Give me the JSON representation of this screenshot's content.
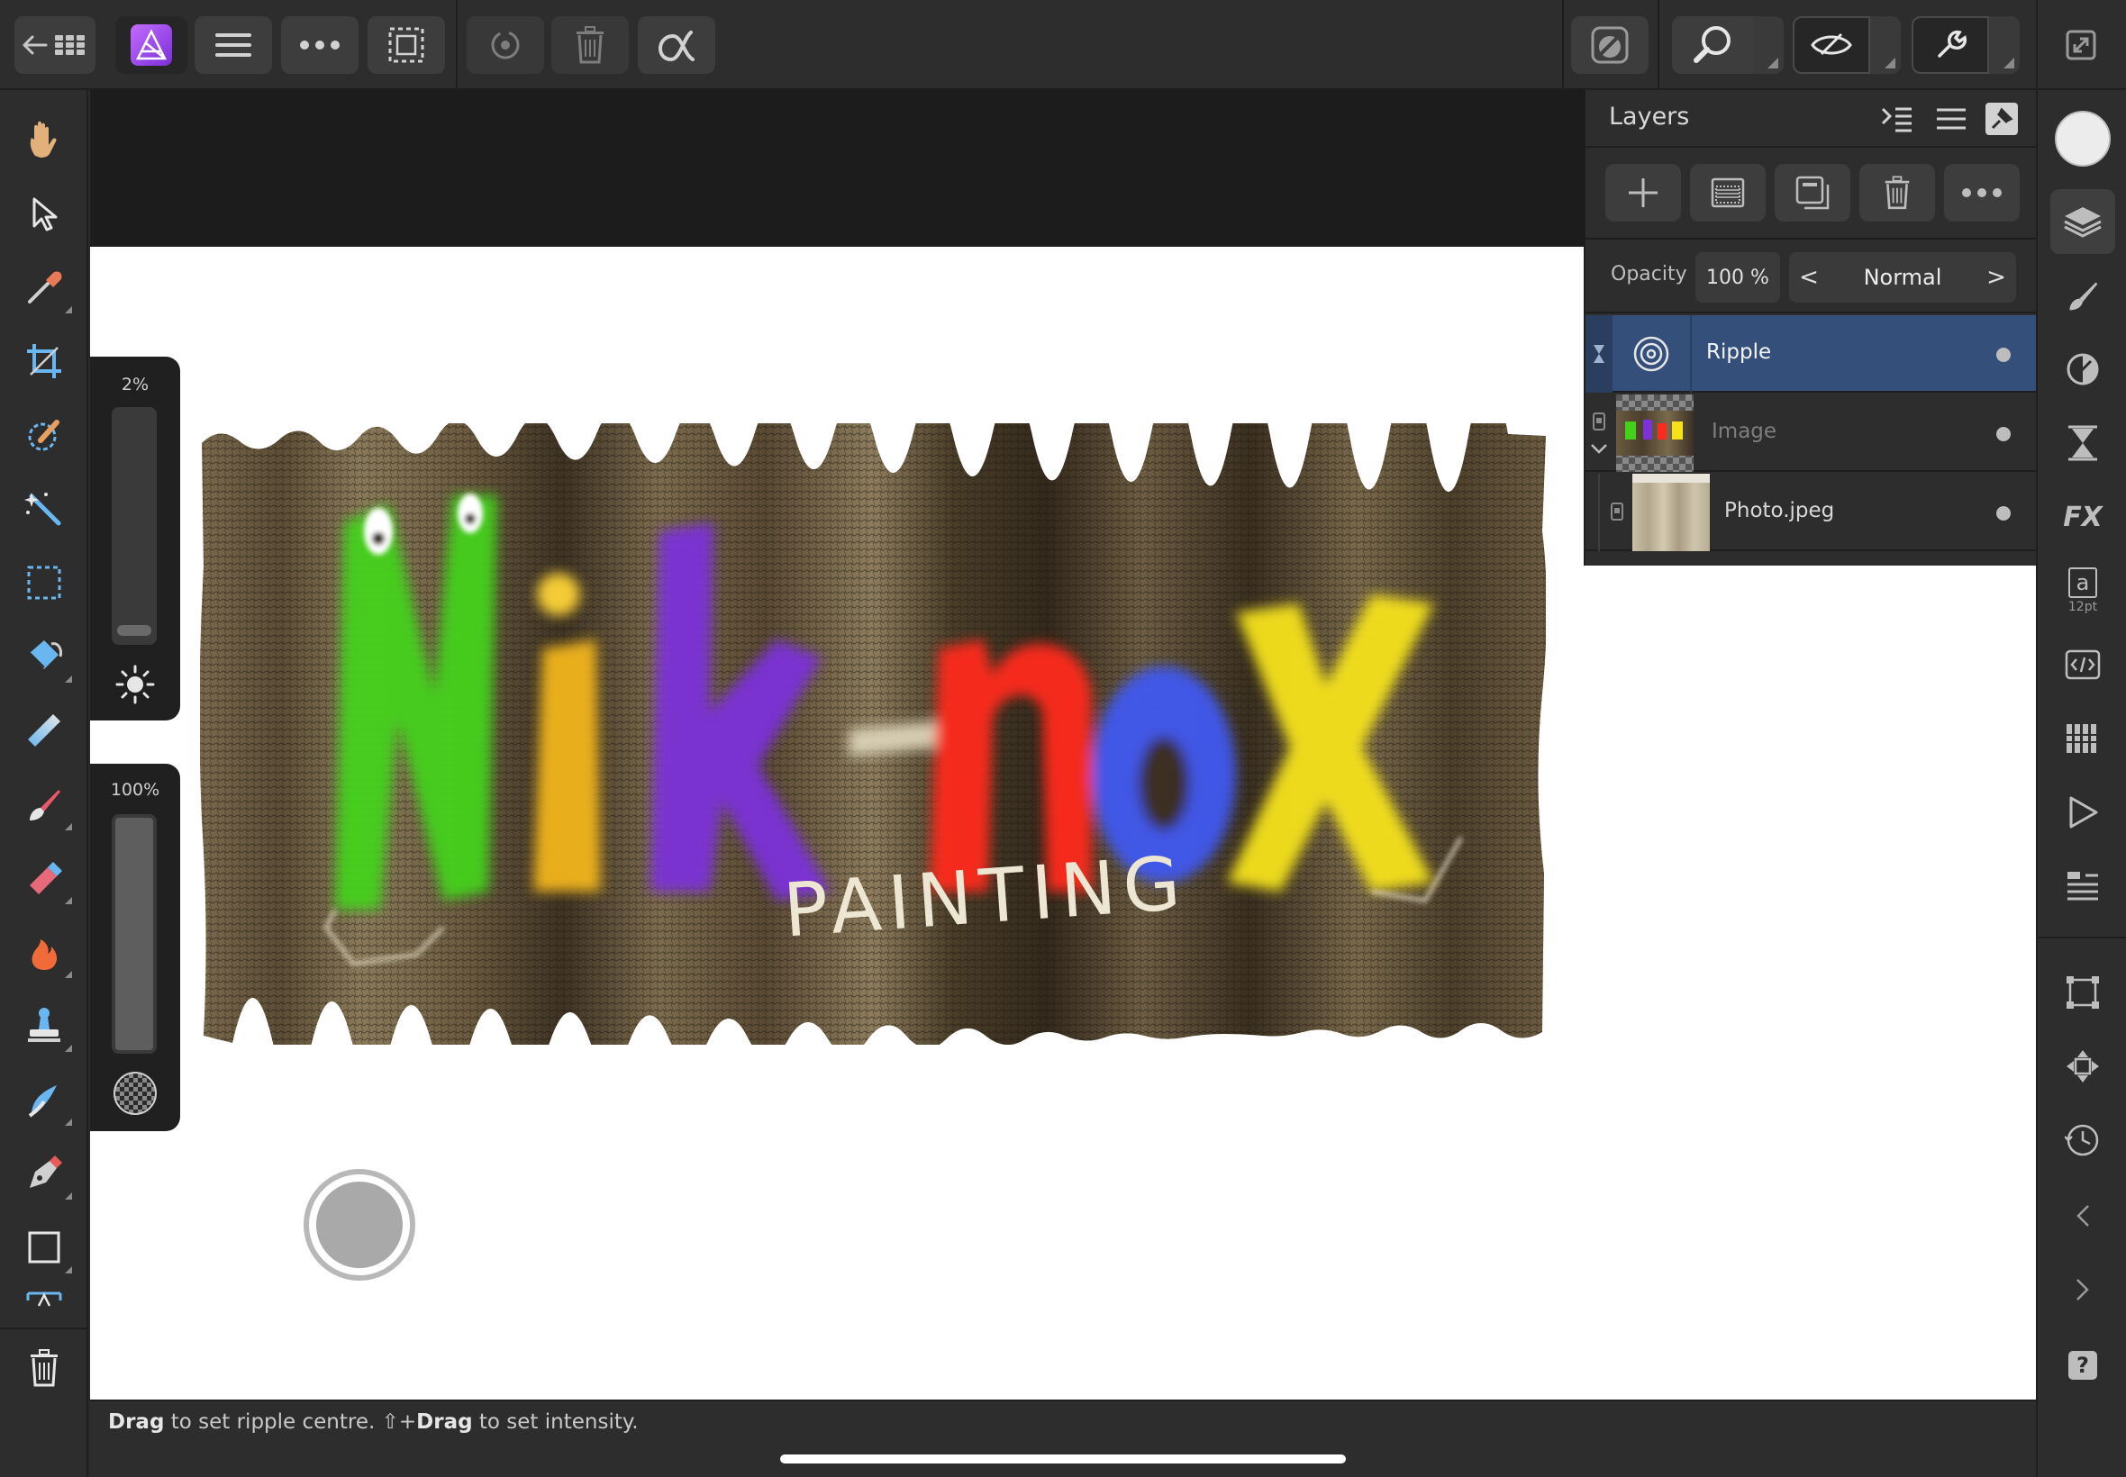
{
  "toolbar": {
    "icons": [
      "back-grid-icon",
      "photo-persona-icon",
      "menu-icon",
      "more-icon",
      "selection-icon",
      "history-icon",
      "delete-icon",
      "alpha-icon",
      "quick-mask-icon",
      "zoom-icon",
      "view-mode-icon",
      "snapping-icon",
      "fullscreen-icon"
    ]
  },
  "left_tools": [
    "hand",
    "move",
    "color-picker",
    "crop",
    "selection-brush",
    "magic-wand",
    "marquee",
    "flood-fill",
    "gradient",
    "paint-brush",
    "erase-brush",
    "burn",
    "clone",
    "smudge",
    "pen",
    "rectangle",
    "text",
    "trash"
  ],
  "canvas": {
    "art_title_painting": "PAINTING",
    "brand_letters": [
      "N",
      "i",
      "k",
      "-",
      "n",
      "o",
      "x"
    ]
  },
  "sliders": {
    "size": {
      "label": "2%",
      "value_pct": 2
    },
    "opacity": {
      "label": "100%",
      "value_pct": 100
    }
  },
  "layers_panel": {
    "title": "Layers",
    "opacity_label": "Opacity",
    "opacity_value": "100 %",
    "blend_prev": "<",
    "blend_mode": "Normal",
    "blend_next": ">",
    "layers": [
      {
        "name": "Ripple",
        "selected": true
      },
      {
        "name": "Image",
        "selected": false
      },
      {
        "name": "Photo.jpeg",
        "selected": false
      }
    ]
  },
  "right_studio": {
    "text_size_label": "12pt",
    "text_glyph": "a",
    "fx_label": "FX",
    "help_label": "?"
  },
  "status": {
    "drag1": "Drag",
    "part1": " to set ripple centre. ⇧+",
    "drag2": "Drag",
    "part2": " to set intensity."
  },
  "colors": {
    "accent_selected": "#34507a",
    "panel": "#2d2d2d",
    "canvas_bg": "#ffffff"
  }
}
